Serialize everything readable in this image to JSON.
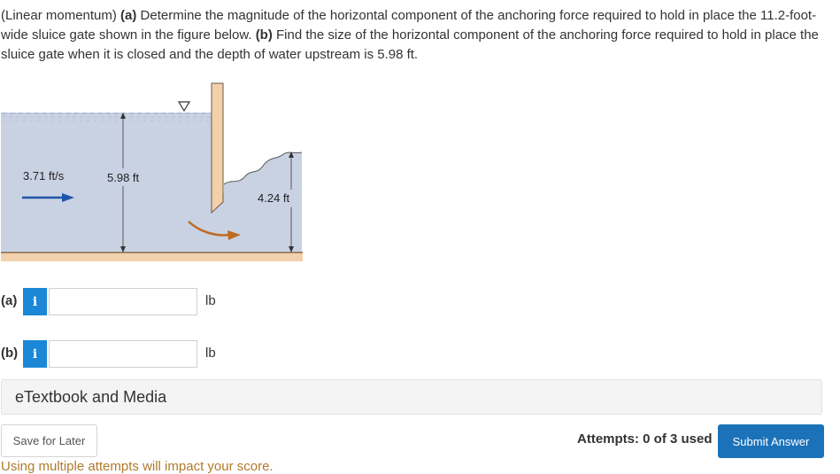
{
  "question": {
    "p1": "(Linear momentum) ",
    "a_tag": "(a)",
    "p2": " Determine the magnitude of the horizontal component of the anchoring force required to hold in place the 11.2-foot-wide sluice gate shown in the figure below. ",
    "b_tag": "(b)",
    "p3": " Find the size of the horizontal component of the anchoring force required to hold in place the sluice gate when it is closed and the depth of water upstream is 5.98 ft."
  },
  "figure": {
    "velocity_label": "3.71 ft/s",
    "upstream_depth_label": "5.98 ft",
    "downstream_depth_label": "4.24 ft",
    "colors": {
      "water": "#c9d2e3",
      "ground": "#f2d2ae",
      "gate": "#f3d0aa",
      "arrow": "#1f55a8",
      "flow_arrow": "#c06a22"
    }
  },
  "answers": [
    {
      "tag": "(a)",
      "info_icon": "i",
      "value": "",
      "unit": "lb"
    },
    {
      "tag": "(b)",
      "info_icon": "i",
      "value": "",
      "unit": "lb"
    }
  ],
  "etextbook": {
    "label": "eTextbook and Media"
  },
  "footer": {
    "save_label": "Save for Later",
    "attempts_text": "Attempts: 0 of 3 used",
    "submit_label": "Submit Answer",
    "warning": "Using multiple attempts will impact your score."
  }
}
